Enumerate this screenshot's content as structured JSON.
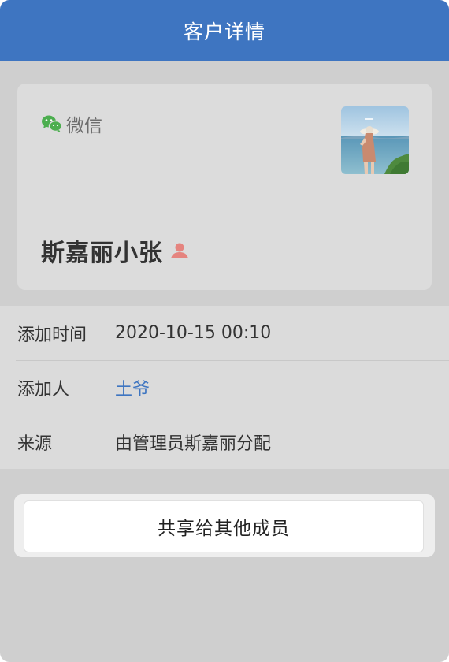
{
  "header": {
    "title": "客户详情"
  },
  "customer_card": {
    "platform_label": "微信",
    "customer_name": "斯嘉丽小张",
    "platform_icon": "wechat-icon",
    "gender_icon": "person-icon",
    "gender_icon_color": "#e5847f"
  },
  "info": {
    "rows": [
      {
        "label": "添加时间",
        "value": "2020-10-15 00:10"
      },
      {
        "label": "添加人",
        "value": "土爷"
      },
      {
        "label": "来源",
        "value": "由管理员斯嘉丽分配"
      }
    ]
  },
  "actions": {
    "share_label": "共享给其他成员"
  },
  "colors": {
    "header_bg": "#3e75c1",
    "link": "#3e75c1",
    "wechat_green": "#4cae4f"
  }
}
